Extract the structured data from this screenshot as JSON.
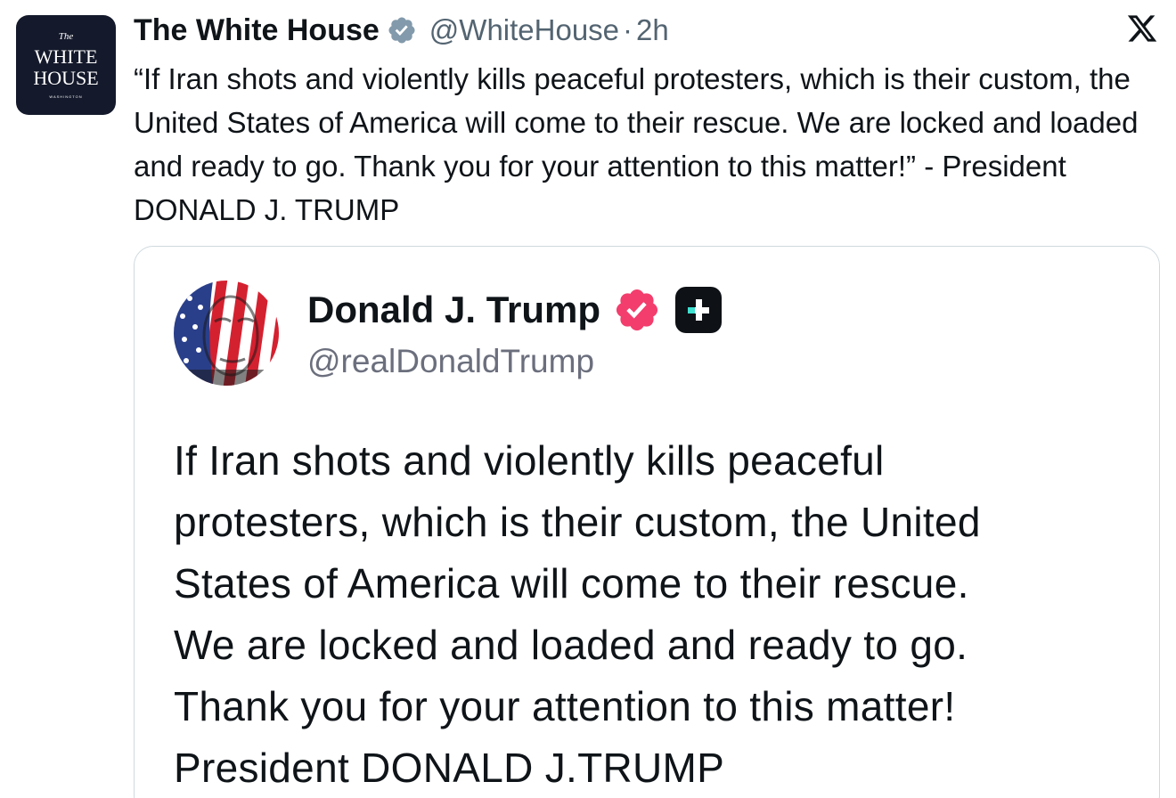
{
  "post": {
    "author": {
      "avatar_lines": [
        "The",
        "WHITE",
        "HOUSE",
        "WASHINGTON"
      ],
      "name": "The White House",
      "handle": "@WhiteHouse",
      "separator": "·",
      "time": "2h",
      "verified_icon": "verified-badge-icon",
      "verified_color": "#829aab"
    },
    "platform_icon": "x-logo-icon",
    "text": "“If Iran shots and violently kills peaceful protesters, which is their custom, the United States of America will come to their rescue. We are locked and loaded and ready to go. Thank you for your attention to this matter!” - President DONALD J. TRUMP"
  },
  "quoted": {
    "name": "Donald J. Trump",
    "handle": "@realDonaldTrump",
    "verified_icon": "pink-verified-badge-icon",
    "verified_color": "#f33d6d",
    "app_icon": "truth-plus-icon",
    "body_lines": [
      "If Iran shots and violently kills peaceful",
      "protesters, which is their custom, the United",
      "States of America will come to their rescue.",
      "We are locked and loaded and ready to go.",
      "Thank you for your attention to this matter!",
      "President DONALD J.TRUMP"
    ]
  }
}
